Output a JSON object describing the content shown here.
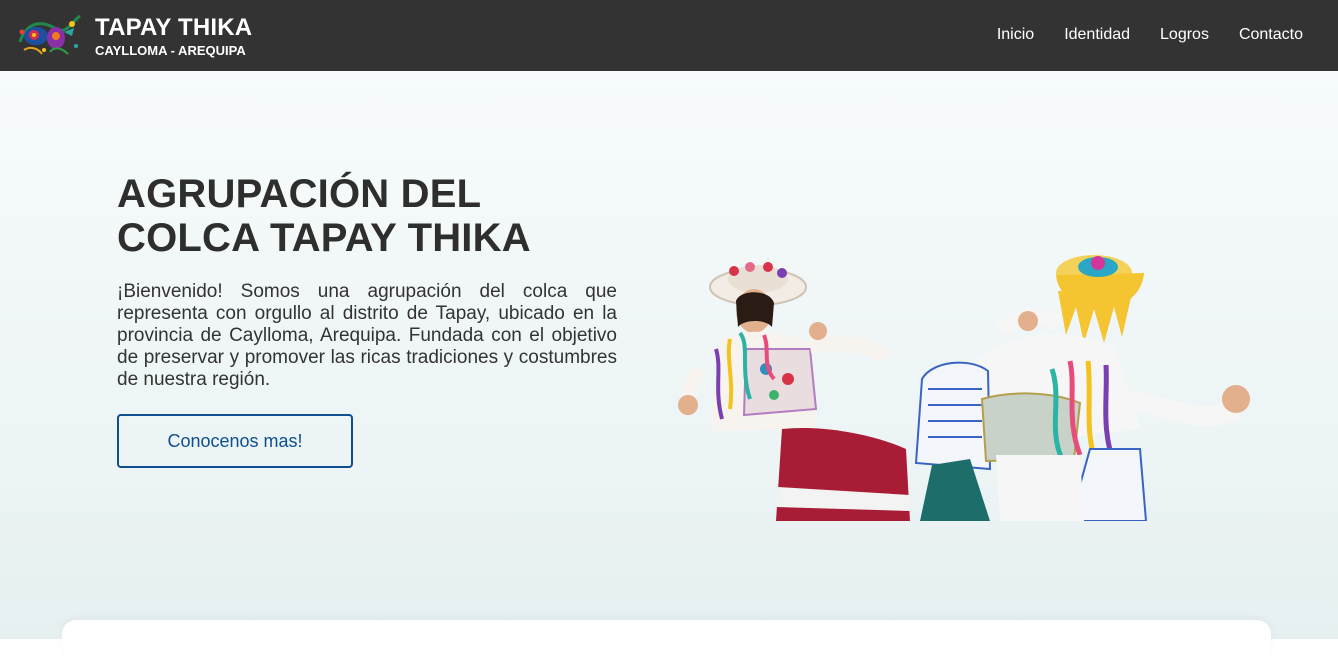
{
  "header": {
    "title": "TAPAY THIKA",
    "subtitle": "CAYLLOMA - AREQUIPA",
    "nav": [
      {
        "label": "Inicio"
      },
      {
        "label": "Identidad"
      },
      {
        "label": "Logros"
      },
      {
        "label": "Contacto"
      }
    ]
  },
  "hero": {
    "title_line1": "AGRUPACIÓN DEL",
    "title_line2": "COLCA TAPAY THIKA",
    "text": "¡Bienvenido! Somos una agrupación del colca que representa con orgullo al distrito de Tapay, ubicado en la provincia de Caylloma, Arequipa. Fundada con el objetivo de preservar y promover las ricas tradiciones y costumbres de nuestra región.",
    "cta_label": "Conocenos mas!"
  },
  "colors": {
    "header_bg": "#333333",
    "accent": "#0d4f8f",
    "hero_title": "#2e2e2e"
  },
  "icons": {
    "logo": "embroidered-bird-logo",
    "hero_image": "traditional-dancers-image"
  }
}
